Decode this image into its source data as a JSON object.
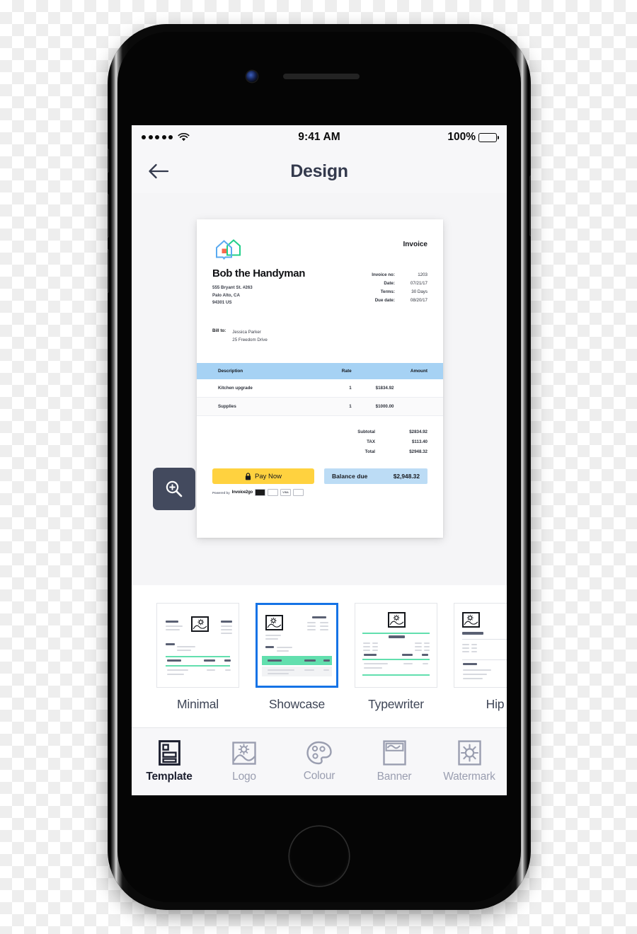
{
  "status_bar": {
    "signal_dots": 5,
    "wifi_icon": "wifi-icon",
    "time": "9:41 AM",
    "battery_percent": "100%",
    "battery_icon": "battery-full-icon"
  },
  "nav": {
    "back_icon": "arrow-left-icon",
    "title": "Design"
  },
  "preview": {
    "zoom_icon": "magnifier-plus-icon"
  },
  "invoice": {
    "logo_icon": "house-logo-icon",
    "heading": "Invoice",
    "business_name": "Bob the Handyman",
    "address_lines": [
      "555 Bryant St. #263",
      "Palo Alto, CA",
      "94301 US"
    ],
    "meta": [
      {
        "key": "Invoice no:",
        "value": "1203"
      },
      {
        "key": "Date:",
        "value": "07/21/17"
      },
      {
        "key": "Terms:",
        "value": "30 Days"
      },
      {
        "key": "Due date:",
        "value": "08/20/17"
      }
    ],
    "bill_to_label": "Bill to:",
    "bill_to_lines": [
      "Jessica Parker",
      "25 Freedom Drive"
    ],
    "table": {
      "columns": [
        "Description",
        "Rate",
        "Amount"
      ],
      "rows": [
        [
          "Kitchen upgrade",
          "1",
          "$1834.92"
        ],
        [
          "Supplies",
          "1",
          "$1000.00"
        ]
      ]
    },
    "totals": [
      {
        "key": "Subtotal",
        "value": "$2834.92"
      },
      {
        "key": "TAX",
        "value": "$113.40"
      },
      {
        "key": "Total",
        "value": "$2948.32"
      }
    ],
    "pay_button": {
      "label": "Pay Now",
      "icon": "lock-icon",
      "color": "#ffd23f"
    },
    "balance": {
      "label": "Balance due",
      "amount": "$2,948.32",
      "color": "#bcdcf5"
    },
    "powered_by": {
      "prefix": "Powered by",
      "brand": "Invoice2go"
    },
    "card_logos": [
      "AMEX",
      "MC",
      "VISA",
      "DISC"
    ],
    "table_header_color": "#a6d2f4"
  },
  "templates": {
    "selected_index": 1,
    "items": [
      {
        "label": "Minimal",
        "accent": "#62dfae"
      },
      {
        "label": "Showcase",
        "accent": "#62dfae"
      },
      {
        "label": "Typewriter",
        "accent": "#62dfae"
      },
      {
        "label": "Hip",
        "accent": "#5a6073"
      }
    ],
    "selection_color": "#1573e6"
  },
  "tab_bar": {
    "active_index": 0,
    "items": [
      {
        "label": "Template",
        "icon": "template-document-icon"
      },
      {
        "label": "Logo",
        "icon": "image-picture-icon"
      },
      {
        "label": "Colour",
        "icon": "palette-icon"
      },
      {
        "label": "Banner",
        "icon": "banner-icon"
      },
      {
        "label": "Watermark",
        "icon": "sun-watermark-icon"
      }
    ]
  }
}
